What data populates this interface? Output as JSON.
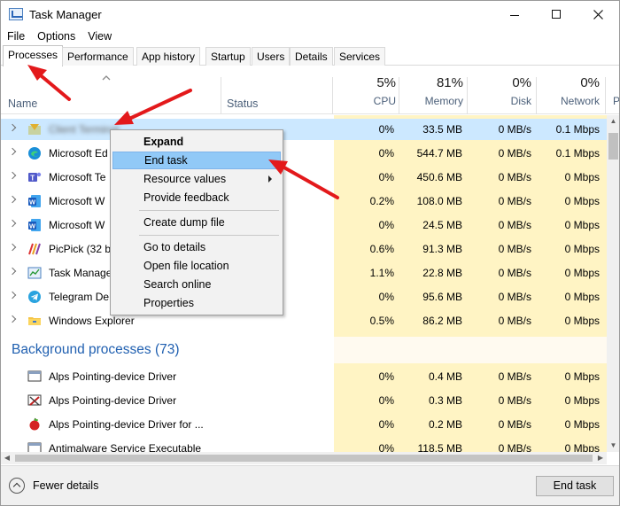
{
  "window": {
    "title": "Task Manager",
    "controls": {
      "minimize": "minimize",
      "maximize": "maximize",
      "close": "close"
    }
  },
  "menu": [
    "File",
    "Options",
    "View"
  ],
  "tabs": [
    "Processes",
    "Performance",
    "App history",
    "Startup",
    "Users",
    "Details",
    "Services"
  ],
  "columns": {
    "name": "Name",
    "status": "Status",
    "cpu": {
      "percent": "5%",
      "label": "CPU"
    },
    "memory": {
      "percent": "81%",
      "label": "Memory"
    },
    "disk": {
      "percent": "0%",
      "label": "Disk"
    },
    "network": {
      "percent": "0%",
      "label": "Network"
    },
    "partial": "P"
  },
  "apps": [
    {
      "name": "Client Terminal",
      "cpu": "0%",
      "memory": "33.5 MB",
      "disk": "0 MB/s",
      "network": "0.1 Mbps",
      "icon": "terminal-icon"
    },
    {
      "name": "Microsoft Ed",
      "cpu": "0%",
      "memory": "544.7 MB",
      "disk": "0 MB/s",
      "network": "0.1 Mbps",
      "icon": "edge-icon"
    },
    {
      "name": "Microsoft Te",
      "cpu": "0%",
      "memory": "450.6 MB",
      "disk": "0 MB/s",
      "network": "0 Mbps",
      "icon": "teams-icon"
    },
    {
      "name": "Microsoft W",
      "cpu": "0.2%",
      "memory": "108.0 MB",
      "disk": "0 MB/s",
      "network": "0 Mbps",
      "icon": "word-icon"
    },
    {
      "name": "Microsoft W",
      "cpu": "0%",
      "memory": "24.5 MB",
      "disk": "0 MB/s",
      "network": "0 Mbps",
      "icon": "word-icon"
    },
    {
      "name": "PicPick (32 b",
      "cpu": "0.6%",
      "memory": "91.3 MB",
      "disk": "0 MB/s",
      "network": "0 Mbps",
      "icon": "picpick-icon"
    },
    {
      "name": "Task Manage",
      "cpu": "1.1%",
      "memory": "22.8 MB",
      "disk": "0 MB/s",
      "network": "0 Mbps",
      "icon": "task-manager-icon"
    },
    {
      "name": "Telegram De",
      "cpu": "0%",
      "memory": "95.6 MB",
      "disk": "0 MB/s",
      "network": "0 Mbps",
      "icon": "telegram-icon"
    },
    {
      "name": "Windows Explorer",
      "cpu": "0.5%",
      "memory": "86.2 MB",
      "disk": "0 MB/s",
      "network": "0 Mbps",
      "icon": "folder-icon"
    }
  ],
  "background": {
    "title": "Background processes (73)",
    "rows": [
      {
        "name": "Alps Pointing-device Driver",
        "cpu": "0%",
        "memory": "0.4 MB",
        "disk": "0 MB/s",
        "network": "0 Mbps",
        "icon": "driver-icon"
      },
      {
        "name": "Alps Pointing-device Driver",
        "cpu": "0%",
        "memory": "0.3 MB",
        "disk": "0 MB/s",
        "network": "0 Mbps",
        "icon": "driver-tools-icon"
      },
      {
        "name": "Alps Pointing-device Driver for ...",
        "cpu": "0%",
        "memory": "0.2 MB",
        "disk": "0 MB/s",
        "network": "0 Mbps",
        "icon": "apple-driver-icon"
      },
      {
        "name": "Antimalware Service Executable",
        "cpu": "0%",
        "memory": "118.5 MB",
        "disk": "0 MB/s",
        "network": "0 Mbps",
        "icon": "antimalware-icon"
      }
    ]
  },
  "context_menu": {
    "items": [
      "Expand",
      "End task",
      "Resource values",
      "Provide feedback",
      "Create dump file",
      "Go to details",
      "Open file location",
      "Search online",
      "Properties"
    ]
  },
  "footer": {
    "fewer_details": "Fewer details",
    "end_task": "End task"
  },
  "colors": {
    "selected_row": "#cce8ff",
    "menu_hover": "#91c9f7",
    "section_title": "#1f5fb0",
    "annotation_arrow": "#e3191b",
    "heat_light": "#fff4c4",
    "heat_medium": "#ffe8a8"
  }
}
